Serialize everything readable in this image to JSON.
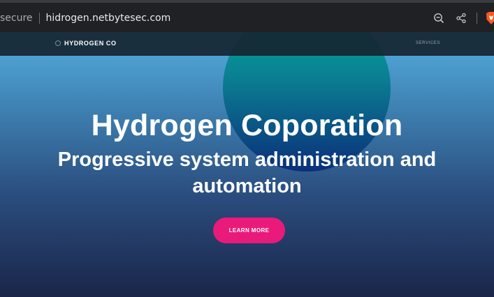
{
  "browser": {
    "secure_label": "secure",
    "url": "hidrogen.netbytesec.com",
    "icons": [
      "zoom-out-icon",
      "share-icon",
      "brave-shield-icon"
    ]
  },
  "site": {
    "nav": {
      "logo_text": "HYDROGEN CO",
      "services_label": "SERVICES"
    },
    "hero": {
      "title": "Hydrogen Coporation",
      "subtitle": "Progressive system administration and automation",
      "cta_label": "LEARN MORE"
    },
    "colors": {
      "cta": "#ea1a7a",
      "gradient_top": "#55aee0",
      "gradient_bottom": "#1a2549",
      "circle_top": "#00b59a",
      "circle_bottom": "#0a2f7a"
    }
  }
}
